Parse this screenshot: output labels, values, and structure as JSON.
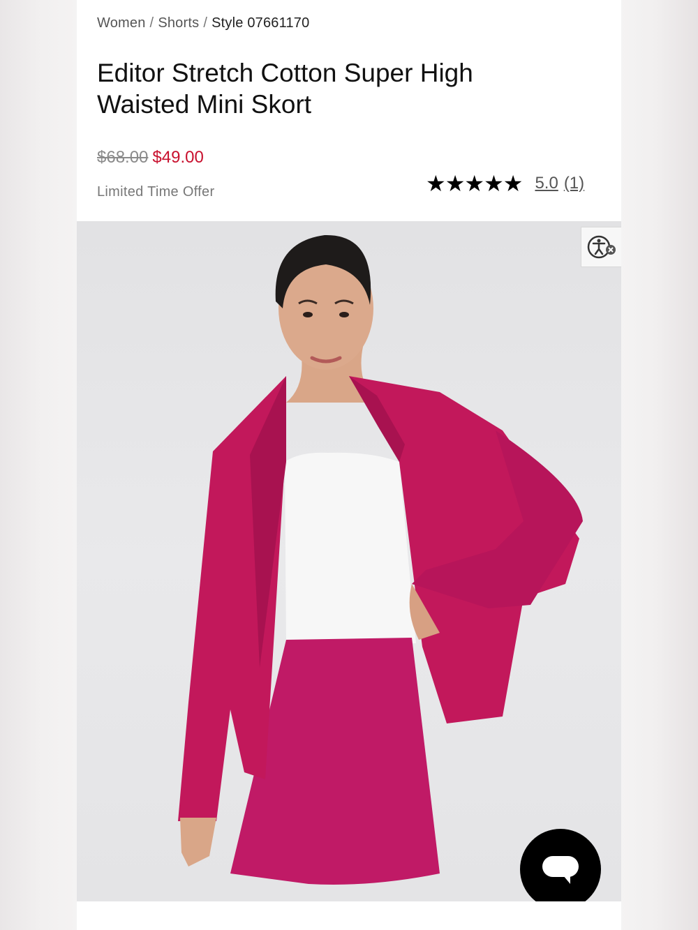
{
  "breadcrumb": {
    "items": [
      "Women",
      "Shorts"
    ],
    "separator": "/",
    "current": "Style 07661170"
  },
  "product": {
    "title": "Editor Stretch Cotton Super High Waisted Mini Skort",
    "original_price": "$68.00",
    "sale_price": "$49.00",
    "offer_text": "Limited Time Offer",
    "rating": {
      "stars": "★★★★★",
      "score": "5.0",
      "count": "(1)"
    }
  },
  "image": {
    "description_icon": "model-wearing-pink-blazer-and-skort"
  },
  "colors": {
    "sale": "#c8102e",
    "garment": "#c2185b",
    "chat_button": "#000000"
  },
  "icons": {
    "accessibility": "accessibility-icon",
    "chat": "chat-icon"
  }
}
